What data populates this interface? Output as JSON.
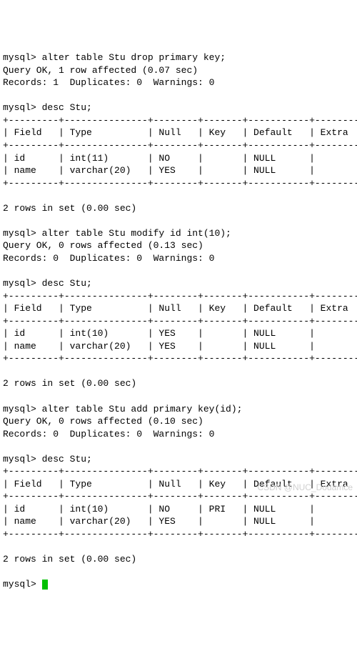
{
  "prompt": "mysql>",
  "blocks": [
    {
      "cmd": "alter table Stu drop primary key;",
      "result": [
        "Query OK, 1 row affected (0.07 sec)",
        "Records: 1  Duplicates: 0  Warnings: 0"
      ]
    },
    {
      "cmd": "desc Stu;",
      "table": {
        "headers": [
          "Field",
          "Type",
          "Null",
          "Key",
          "Default",
          "Extra"
        ],
        "widths": [
          7,
          13,
          6,
          5,
          9,
          7
        ],
        "rows": [
          [
            "id",
            "int(11)",
            "NO",
            "",
            "NULL",
            ""
          ],
          [
            "name",
            "varchar(20)",
            "YES",
            "",
            "NULL",
            ""
          ]
        ]
      },
      "footer": "2 rows in set (0.00 sec)"
    },
    {
      "cmd": "alter table Stu modify id int(10);",
      "result": [
        "Query OK, 0 rows affected (0.13 sec)",
        "Records: 0  Duplicates: 0  Warnings: 0"
      ]
    },
    {
      "cmd": "desc Stu;",
      "table": {
        "headers": [
          "Field",
          "Type",
          "Null",
          "Key",
          "Default",
          "Extra"
        ],
        "widths": [
          7,
          13,
          6,
          5,
          9,
          7
        ],
        "rows": [
          [
            "id",
            "int(10)",
            "YES",
            "",
            "NULL",
            ""
          ],
          [
            "name",
            "varchar(20)",
            "YES",
            "",
            "NULL",
            ""
          ]
        ]
      },
      "footer": "2 rows in set (0.00 sec)"
    },
    {
      "cmd": "alter table Stu add primary key(id);",
      "result": [
        "Query OK, 0 rows affected (0.10 sec)",
        "Records: 0  Duplicates: 0  Warnings: 0"
      ]
    },
    {
      "cmd": "desc Stu;",
      "table": {
        "headers": [
          "Field",
          "Type",
          "Null",
          "Key",
          "Default",
          "Extra"
        ],
        "widths": [
          7,
          13,
          6,
          5,
          9,
          7
        ],
        "rows": [
          [
            "id",
            "int(10)",
            "NO",
            "PRI",
            "NULL",
            ""
          ],
          [
            "name",
            "varchar(20)",
            "YES",
            "",
            "NULL",
            ""
          ]
        ]
      },
      "footer": "2 rows in set (0.00 sec)"
    }
  ],
  "final_prompt": "mysql>",
  "watermark": "CSDN @NUC_Dodamce"
}
